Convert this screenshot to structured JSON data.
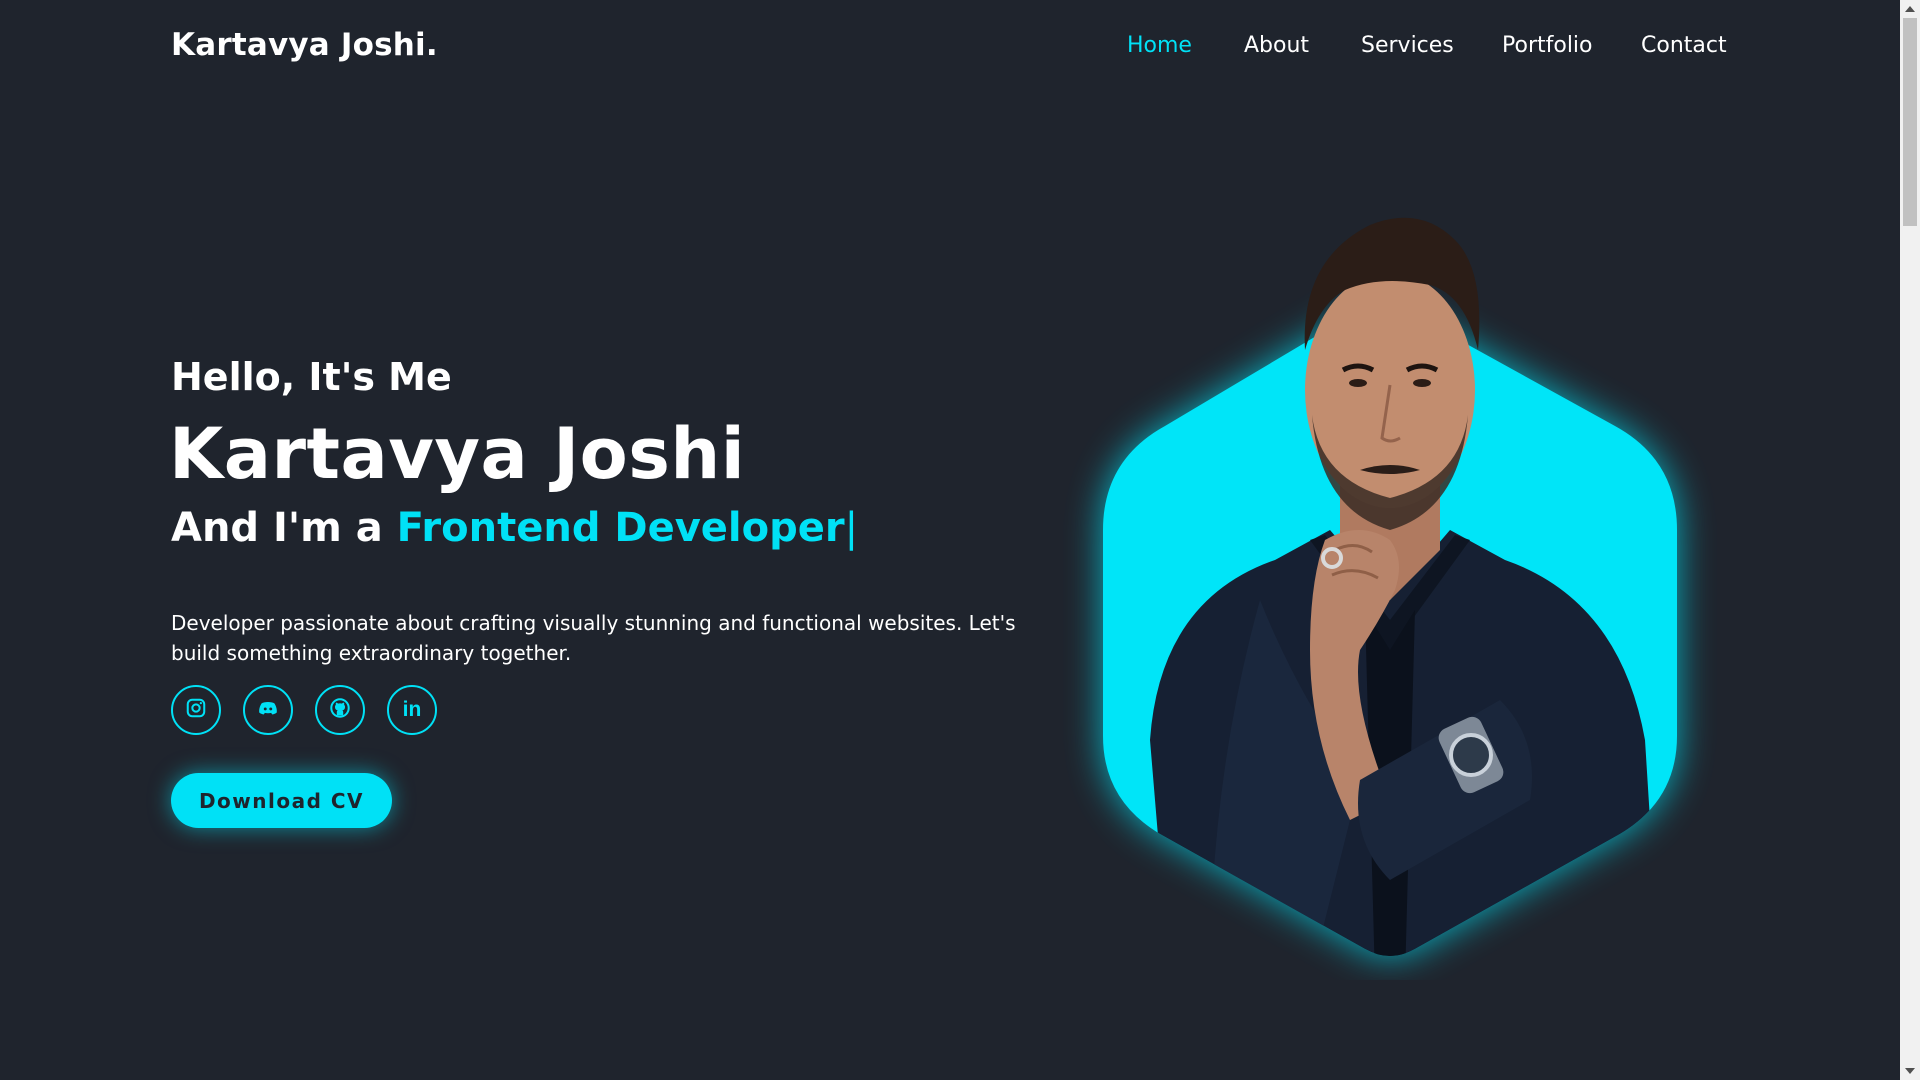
{
  "header": {
    "logo": "Kartavya Joshi.",
    "nav": [
      {
        "label": "Home",
        "active": true
      },
      {
        "label": "About",
        "active": false
      },
      {
        "label": "Services",
        "active": false
      },
      {
        "label": "Portfolio",
        "active": false
      },
      {
        "label": "Contact",
        "active": false
      }
    ]
  },
  "hero": {
    "greeting": "Hello, It's Me",
    "name": "Kartavya Joshi",
    "role_prefix": "And I'm a ",
    "role": "Frontend Developer",
    "cursor": "|",
    "description": "Developer passionate about crafting visually stunning and functional websites. Let's build something extraordinary together.",
    "socials": [
      {
        "name": "instagram-icon"
      },
      {
        "name": "discord-icon"
      },
      {
        "name": "github-icon"
      },
      {
        "name": "linkedin-icon",
        "text": "in"
      }
    ],
    "button_label": "Download CV"
  },
  "colors": {
    "background": "#1f242d",
    "accent": "#00e1f6",
    "text": "#ffffff"
  }
}
